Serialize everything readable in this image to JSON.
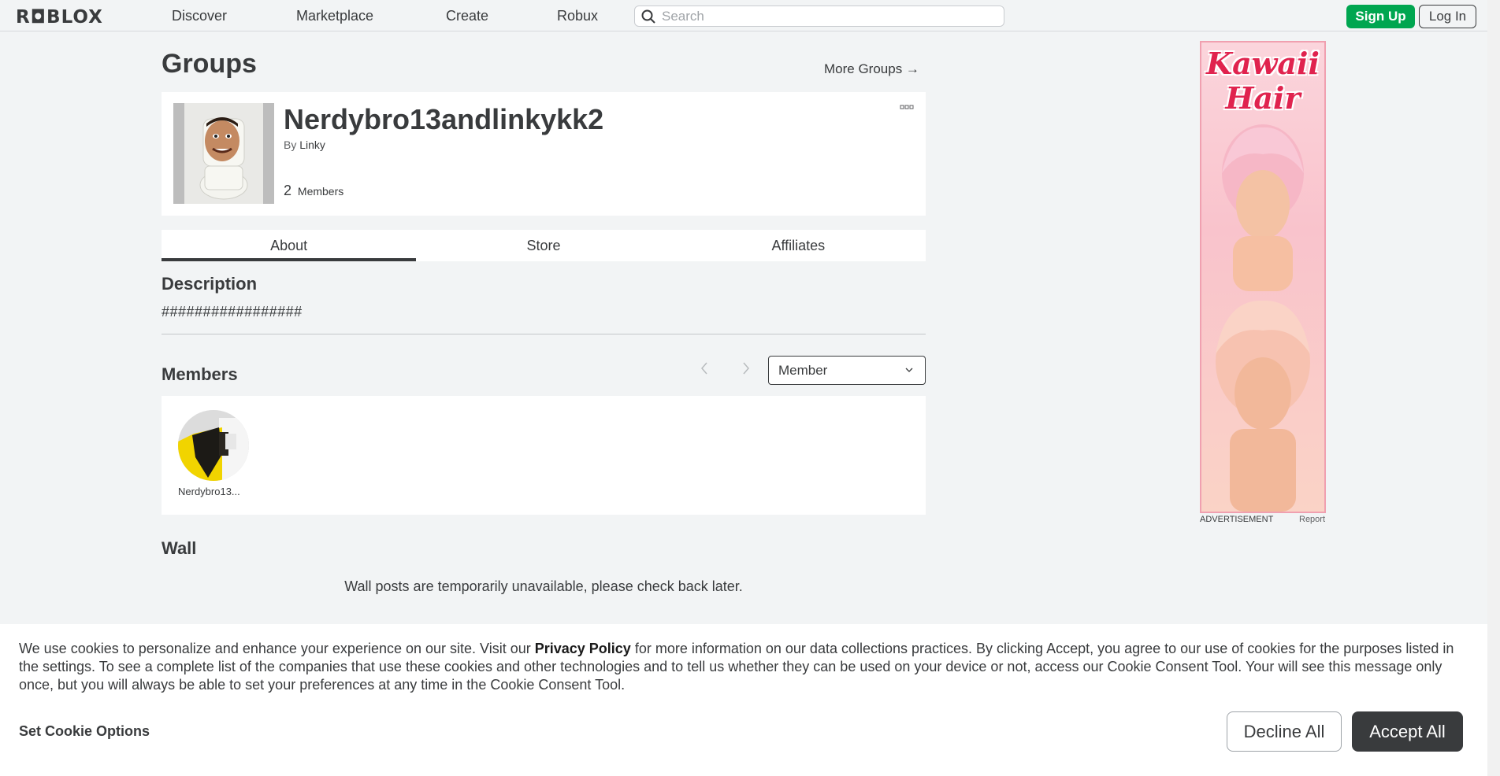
{
  "nav": {
    "logo": "R◘BLOX",
    "links": [
      "Discover",
      "Marketplace",
      "Create",
      "Robux"
    ],
    "search_placeholder": "Search",
    "signup_label": "Sign Up",
    "login_label": "Log In"
  },
  "page": {
    "title": "Groups",
    "more_groups": "More Groups →"
  },
  "group": {
    "name": "Nerdybro13andlinkykk2",
    "by_prefix": "By",
    "owner": "Linky",
    "member_count": "2",
    "member_label": "Members"
  },
  "tabs": [
    "About",
    "Store",
    "Affiliates"
  ],
  "about": {
    "description_title": "Description",
    "description_text": "#################",
    "members_title": "Members",
    "role_selected": "Member",
    "members": [
      {
        "name": "Nerdybro13..."
      }
    ],
    "wall_title": "Wall",
    "wall_message": "Wall posts are temporarily unavailable, please check back later."
  },
  "ad": {
    "title_line1": "Kawaii",
    "title_line2": "Hair",
    "label": "ADVERTISEMENT",
    "report": "Report"
  },
  "cookie": {
    "text_before": "We use cookies to personalize and enhance your experience on our site. Visit our ",
    "privacy_link": "Privacy Policy",
    "text_after": " for more information on our data collections practices. By clicking Accept, you agree to our use of cookies for the purposes listed in the settings. To see a complete list of the companies that use these cookies and other technologies and to tell us whether they can be used on your device or not, access our Cookie Consent Tool. Your will see this message only once, but you will always be able to set your preferences at any time in the Cookie Consent Tool.",
    "options_label": "Set Cookie Options",
    "decline_label": "Decline All",
    "accept_label": "Accept All"
  },
  "colors": {
    "accent_green": "#00a650",
    "text_dark": "#393b3d",
    "background": "#f2f4f5"
  }
}
